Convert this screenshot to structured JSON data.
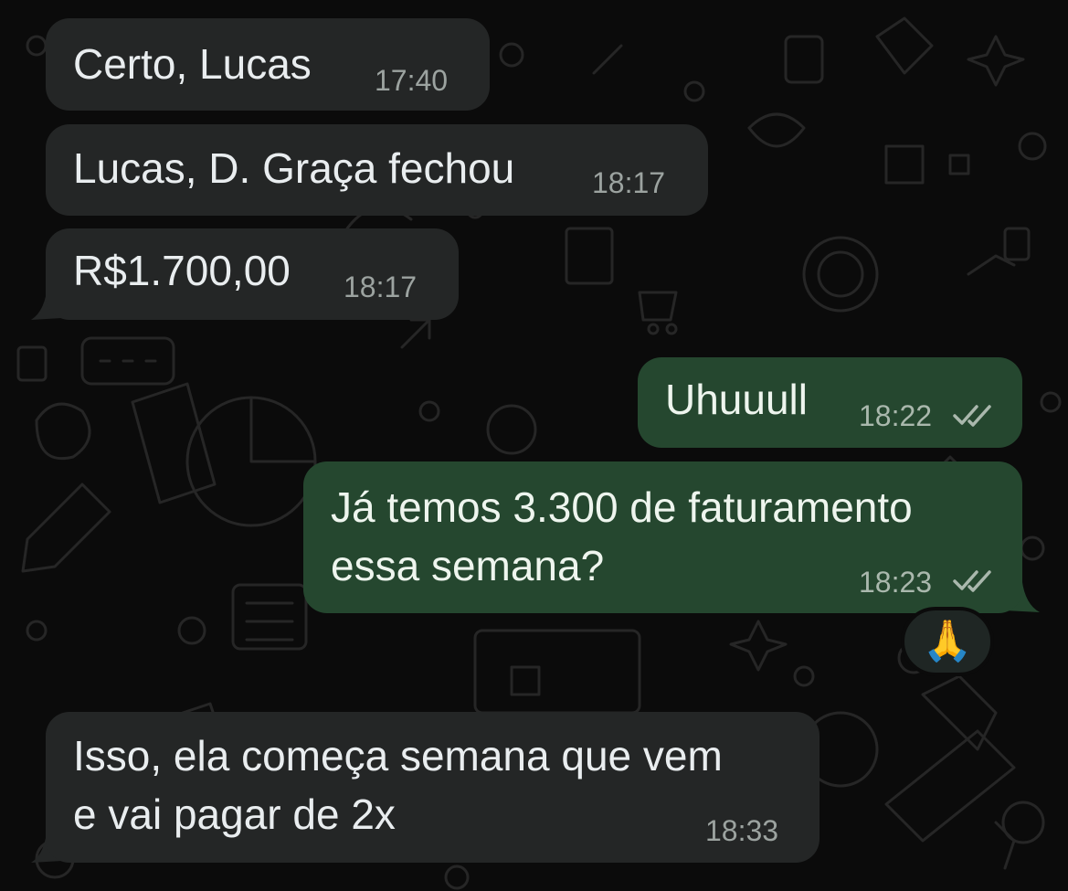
{
  "messages": [
    {
      "direction": "incoming",
      "text": "Certo, Lucas",
      "time": "17:40"
    },
    {
      "direction": "incoming",
      "text": "Lucas, D. Graça fechou",
      "time": "18:17"
    },
    {
      "direction": "incoming",
      "text": "R$1.700,00",
      "time": "18:17"
    },
    {
      "direction": "outgoing",
      "text": "Uhuuull",
      "time": "18:22",
      "status": "read"
    },
    {
      "direction": "outgoing",
      "text": "Já temos 3.300 de faturamento\nessa semana?",
      "time": "18:23",
      "status": "read"
    },
    {
      "direction": "incoming",
      "text": "Isso, ela começa semana que vem\ne vai pagar de 2x",
      "time": "18:33"
    }
  ],
  "reaction": {
    "emoji": "🙏",
    "on_message": 4
  },
  "colors": {
    "background": "#0b0b0b",
    "incoming_bubble": "#242626",
    "outgoing_bubble": "#25472f",
    "timestamp": "#9ca3a0",
    "read_ticks": "#aab8ad"
  },
  "icons": {
    "read_status": "double-check-icon",
    "wallpaper": "doodle-pattern"
  }
}
